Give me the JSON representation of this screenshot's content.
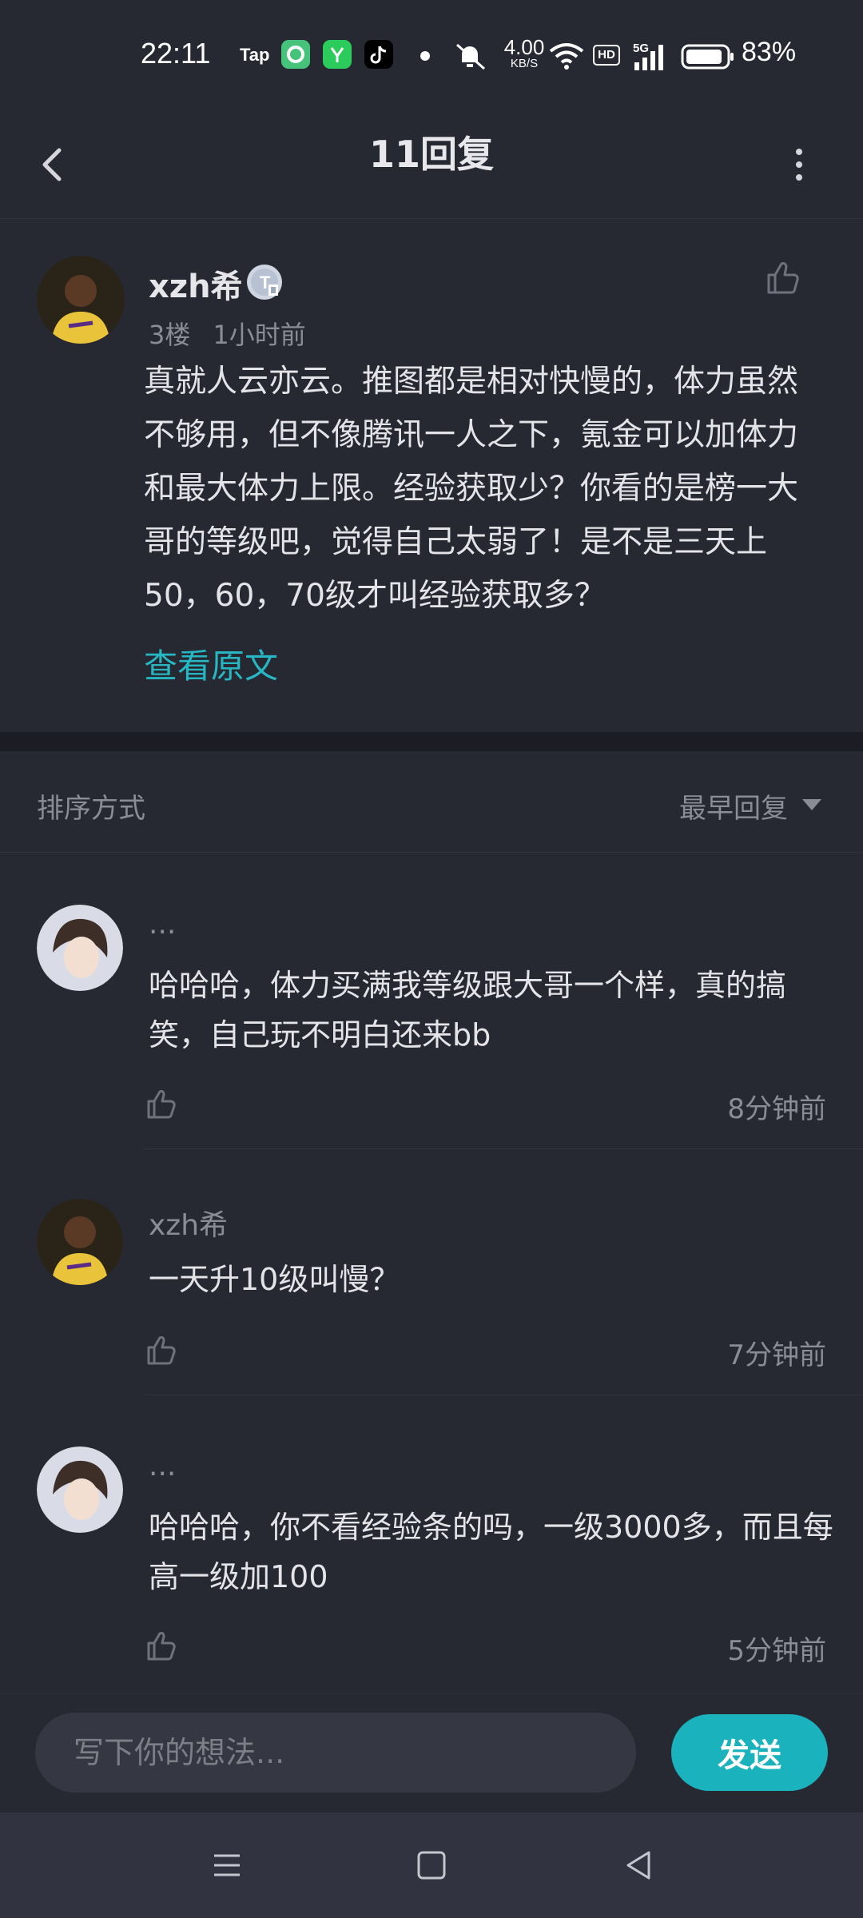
{
  "status_bar": {
    "time": "22:11",
    "tap_label": "Tap",
    "net_speed": "4.00",
    "net_unit": "KB/S",
    "hd": "HD",
    "network_type": "5G",
    "battery": "83%",
    "icons": [
      "taptap-icon",
      "green-app-icon",
      "wechat-icon",
      "tiktok-icon",
      "dot-icon",
      "mute-icon",
      "wifi-icon",
      "signal-icon",
      "battery-icon"
    ]
  },
  "header": {
    "title": "11回复",
    "back_icon": "chevron-left-icon",
    "more_icon": "more-vertical-icon"
  },
  "post": {
    "author": "xzh希",
    "badge": "T",
    "floor": "3楼",
    "time": "1小时前",
    "content": "真就人云亦云。推图都是相对快慢的，体力虽然不够用，但不像腾讯一人之下，氪金可以加体力和最大体力上限。经验获取少？你看的是榜一大哥的等级吧，觉得自己太弱了！是不是三天上50，60，70级才叫经验获取多？",
    "view_original": "查看原文"
  },
  "sort": {
    "label": "排序方式",
    "value": "最早回复"
  },
  "replies": [
    {
      "name": "...",
      "text": "哈哈哈，体力买满我等级跟大哥一个样，真的搞笑，自己玩不明白还来bb",
      "time": "8分钟前"
    },
    {
      "name": "xzh希",
      "text": "一天升10级叫慢？",
      "time": "7分钟前"
    },
    {
      "name": "...",
      "text": "哈哈哈，你不看经验条的吗，一级3000多，而且每高一级加100",
      "time": "5分钟前"
    }
  ],
  "composer": {
    "placeholder": "写下你的想法...",
    "send_label": "发送"
  },
  "colors": {
    "background": "#262832",
    "accent": "#19b2bd",
    "link": "#27b7c3",
    "muted": "#8a8c96"
  }
}
